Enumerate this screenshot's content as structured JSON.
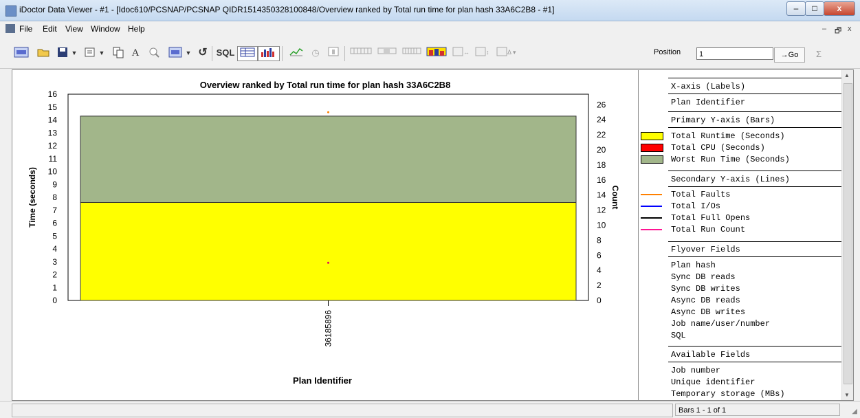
{
  "window": {
    "title": "iDoctor Data Viewer - #1 - [Idoc610/PCSNAP/PCSNAP   QIDR1514350328100848/Overview ranked by Total run time for plan hash 33A6C2B8 - #1]",
    "minimize_glyph": "–",
    "maximize_glyph": "□",
    "close_glyph": "x"
  },
  "menu": {
    "items": [
      "File",
      "Edit",
      "View",
      "Window",
      "Help"
    ],
    "mdi_minimize": "–",
    "mdi_restore": "🗗",
    "mdi_close": "x"
  },
  "toolbar": {
    "sql_label": "SQL",
    "font_label": "A",
    "position_label": "Position",
    "position_value": "1",
    "go_label": "→Go",
    "sigma_label": "Σ"
  },
  "chart_data": {
    "type": "bar",
    "title": "Overview ranked by Total run time for plan hash 33A6C2B8",
    "xlabel": "Plan Identifier",
    "ylabel": "Time (seconds)",
    "y2label": "Count",
    "categories": [
      "36185896"
    ],
    "ylim": [
      0,
      16
    ],
    "y2lim": [
      0,
      27.4
    ],
    "y_ticks": [
      0,
      1,
      2,
      3,
      4,
      5,
      6,
      7,
      8,
      9,
      10,
      11,
      12,
      13,
      14,
      15,
      16
    ],
    "y2_ticks": [
      0,
      2,
      4,
      6,
      8,
      10,
      12,
      14,
      16,
      18,
      20,
      22,
      24,
      26
    ],
    "series": [
      {
        "name": "Total Runtime (Seconds)",
        "values": [
          7.6
        ],
        "color": "#ffff00"
      },
      {
        "name": "Worst Run Time (Seconds)",
        "values": [
          14.3
        ],
        "color": "#a2b68a"
      }
    ],
    "line_points": [
      {
        "name": "Total Faults",
        "value": 25.0,
        "color": "#ff8000"
      },
      {
        "name": "Total Run Count",
        "value": 5.0,
        "color": "#e0105a"
      }
    ]
  },
  "legend": {
    "sections": [
      {
        "header": "X-axis (Labels)",
        "items": [
          {
            "label": "Plan Identifier"
          }
        ]
      },
      {
        "header": "Primary Y-axis (Bars)",
        "items": [
          {
            "label": "Total Runtime (Seconds)",
            "swatch": "#ffff00"
          },
          {
            "label": "Total CPU (Seconds)",
            "swatch": "#ff0000"
          },
          {
            "label": "Worst Run Time (Seconds)",
            "swatch": "#a2b68a"
          }
        ]
      },
      {
        "header": "Secondary Y-axis (Lines)",
        "items": [
          {
            "label": "Total Faults",
            "line": "#ff8000"
          },
          {
            "label": "Total I/Os",
            "line": "#0000ff"
          },
          {
            "label": "Total Full Opens",
            "line": "#000000"
          },
          {
            "label": "Total Run Count",
            "line": "#ff1493"
          }
        ]
      },
      {
        "header": "Flyover Fields",
        "items": [
          {
            "label": "Plan hash"
          },
          {
            "label": "Sync DB reads"
          },
          {
            "label": "Sync DB writes"
          },
          {
            "label": "Async DB reads"
          },
          {
            "label": "Async DB writes"
          },
          {
            "label": "Job name/user/number"
          },
          {
            "label": "SQL"
          }
        ]
      },
      {
        "header": "Available Fields",
        "items": [
          {
            "label": "Job number"
          },
          {
            "label": "Unique identifier"
          },
          {
            "label": "Temporary storage (MBs)"
          }
        ]
      }
    ]
  },
  "status": {
    "bars_text": "Bars 1 - 1 of 1"
  }
}
